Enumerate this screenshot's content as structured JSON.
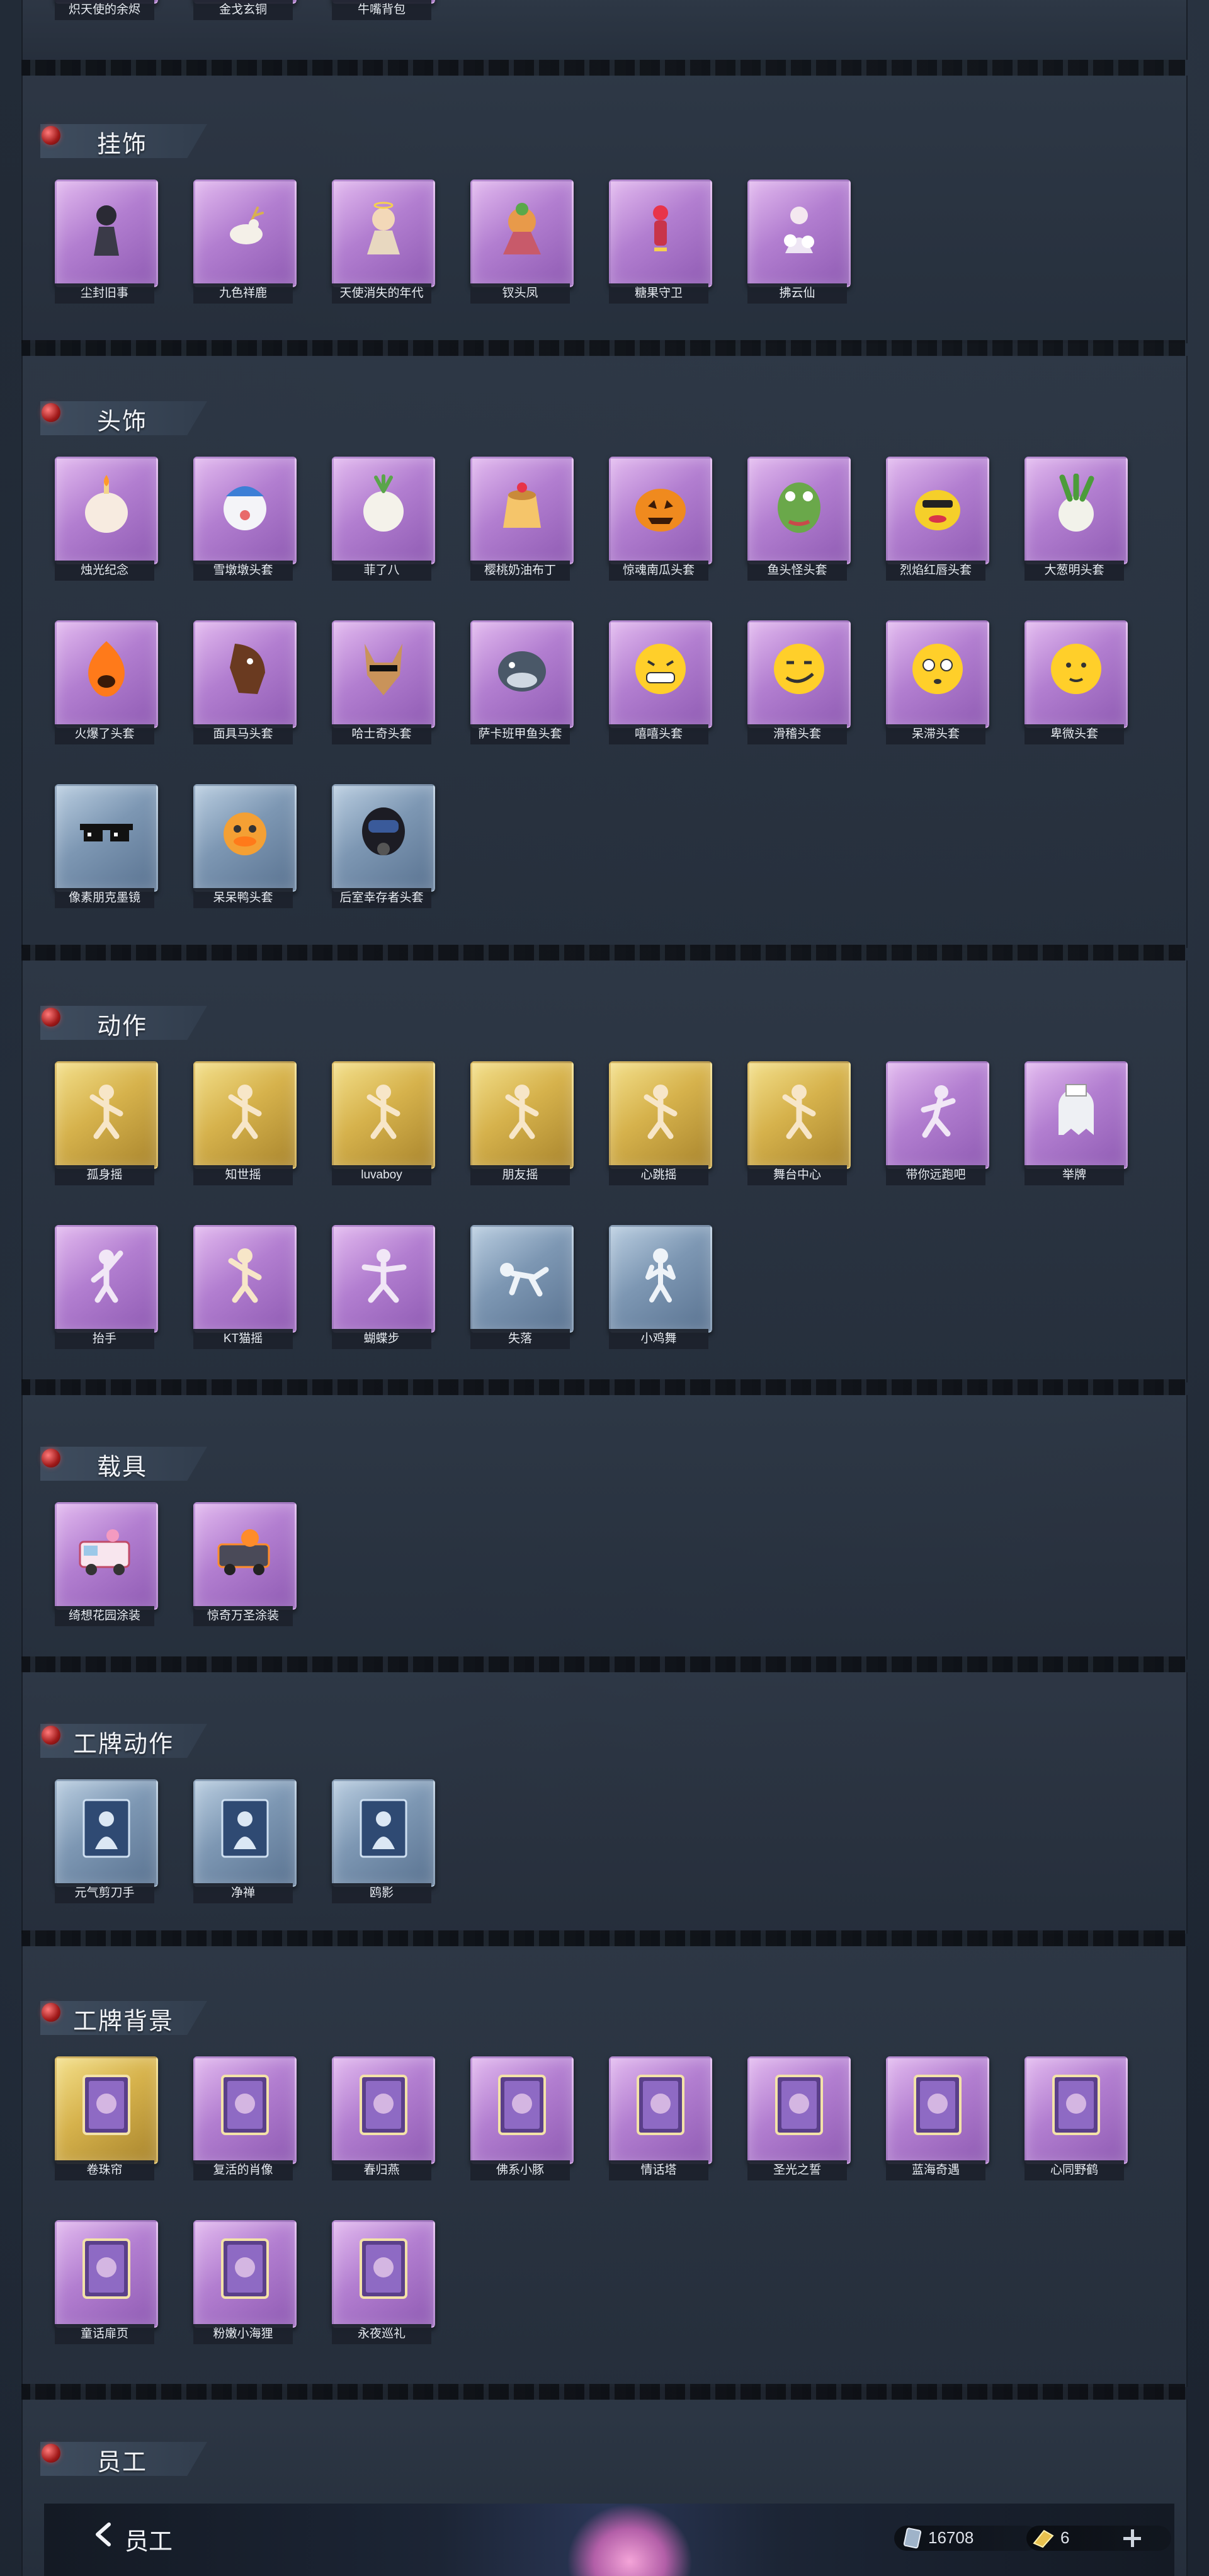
{
  "top_row": [
    {
      "label": "炽天使的余烬",
      "color": "purple"
    },
    {
      "label": "金戈玄铜",
      "color": "purple"
    },
    {
      "label": "牛嘴背包",
      "color": "purple"
    }
  ],
  "sections": {
    "pendant": {
      "title": "挂饰",
      "items": [
        {
          "label": "尘封旧事",
          "color": "purple",
          "icon": "figure-icon"
        },
        {
          "label": "九色祥鹿",
          "color": "purple",
          "icon": "deer-icon"
        },
        {
          "label": "天使消失的年代",
          "color": "purple",
          "icon": "angel-icon"
        },
        {
          "label": "钗头凤",
          "color": "purple",
          "icon": "phoenix-icon"
        },
        {
          "label": "糖果守卫",
          "color": "purple",
          "icon": "candy-guard-icon"
        },
        {
          "label": "拂云仙",
          "color": "purple",
          "icon": "cloud-fairy-icon"
        }
      ]
    },
    "headwear": {
      "title": "头饰",
      "items": [
        {
          "label": "烛光纪念",
          "color": "purple",
          "icon": "candle-head-icon"
        },
        {
          "label": "雪墩墩头套",
          "color": "purple",
          "icon": "snow-bear-icon"
        },
        {
          "label": "菲了八",
          "color": "purple",
          "icon": "radish-icon"
        },
        {
          "label": "樱桃奶油布丁",
          "color": "purple",
          "icon": "pudding-icon"
        },
        {
          "label": "惊魂南瓜头套",
          "color": "purple",
          "icon": "pumpkin-icon"
        },
        {
          "label": "鱼头怪头套",
          "color": "purple",
          "icon": "fish-head-icon"
        },
        {
          "label": "烈焰红唇头套",
          "color": "purple",
          "icon": "yellow-creature-icon"
        },
        {
          "label": "大葱明头套",
          "color": "purple",
          "icon": "scallion-icon"
        },
        {
          "label": "火爆了头套",
          "color": "purple",
          "icon": "fire-spirit-icon"
        },
        {
          "label": "面具马头套",
          "color": "purple",
          "icon": "horse-head-icon"
        },
        {
          "label": "哈士奇头套",
          "color": "purple",
          "icon": "husky-icon"
        },
        {
          "label": "萨卡班甲鱼头套",
          "color": "purple",
          "icon": "grey-fish-icon"
        },
        {
          "label": "嘻嘻头套",
          "color": "purple",
          "icon": "grin-emoji-icon"
        },
        {
          "label": "滑稽头套",
          "color": "purple",
          "icon": "smirk-emoji-icon"
        },
        {
          "label": "呆滞头套",
          "color": "purple",
          "icon": "dazed-emoji-icon"
        },
        {
          "label": "卑微头套",
          "color": "purple",
          "icon": "humble-emoji-icon"
        },
        {
          "label": "像素朋克墨镜",
          "color": "blue",
          "icon": "pixel-sunglasses-icon"
        },
        {
          "label": "呆呆鸭头套",
          "color": "blue",
          "icon": "duck-head-icon"
        },
        {
          "label": "后室幸存者头套",
          "color": "blue",
          "icon": "gas-mask-icon"
        }
      ]
    },
    "actions": {
      "title": "动作",
      "items": [
        {
          "label": "孤身摇",
          "color": "gold",
          "icon": "dance-pose-icon"
        },
        {
          "label": "知世摇",
          "color": "gold",
          "icon": "dance-pose-icon"
        },
        {
          "label": "luvaboy",
          "color": "gold",
          "icon": "dance-pose-icon"
        },
        {
          "label": "朋友摇",
          "color": "gold",
          "icon": "dance-pose-icon"
        },
        {
          "label": "心跳摇",
          "color": "gold",
          "icon": "dance-pose-icon"
        },
        {
          "label": "舞台中心",
          "color": "gold",
          "icon": "dance-pose-icon"
        },
        {
          "label": "带你远跑吧",
          "color": "purple",
          "icon": "run-pose-icon"
        },
        {
          "label": "举牌",
          "color": "purple",
          "icon": "ghost-sign-icon"
        },
        {
          "label": "抬手",
          "color": "purple",
          "icon": "raise-hand-icon"
        },
        {
          "label": "KT猫摇",
          "color": "purple",
          "icon": "dance-pose-icon"
        },
        {
          "label": "蝴蝶步",
          "color": "purple",
          "icon": "butterfly-step-icon"
        },
        {
          "label": "失落",
          "color": "blue",
          "icon": "crawl-pose-icon"
        },
        {
          "label": "小鸡舞",
          "color": "blue",
          "icon": "chicken-dance-icon"
        }
      ]
    },
    "vehicle": {
      "title": "载具",
      "items": [
        {
          "label": "绮想花园涂装",
          "color": "purple",
          "icon": "ice-cream-truck-icon"
        },
        {
          "label": "惊奇万圣涂装",
          "color": "purple",
          "icon": "halloween-truck-icon"
        }
      ]
    },
    "badge_action": {
      "title": "工牌动作",
      "items": [
        {
          "label": "元气剪刀手",
          "color": "blue",
          "icon": "silhouette-card-icon"
        },
        {
          "label": "净禅",
          "color": "blue",
          "icon": "silhouette-card-icon"
        },
        {
          "label": "鸥影",
          "color": "blue",
          "icon": "silhouette-card-icon"
        }
      ]
    },
    "badge_bg": {
      "title": "工牌背景",
      "items": [
        {
          "label": "卷珠帘",
          "color": "gold",
          "icon": "card-frame-icon"
        },
        {
          "label": "复活的肖像",
          "color": "purple",
          "icon": "card-frame-icon"
        },
        {
          "label": "春归燕",
          "color": "purple",
          "icon": "card-frame-icon"
        },
        {
          "label": "佛系小豚",
          "color": "purple",
          "icon": "card-frame-icon"
        },
        {
          "label": "情话塔",
          "color": "purple",
          "icon": "card-frame-icon"
        },
        {
          "label": "圣光之誓",
          "color": "purple",
          "icon": "card-frame-icon"
        },
        {
          "label": "蓝海奇遇",
          "color": "purple",
          "icon": "card-frame-icon"
        },
        {
          "label": "心同野鹤",
          "color": "purple",
          "icon": "card-frame-icon"
        },
        {
          "label": "童话扉页",
          "color": "purple",
          "icon": "card-frame-icon"
        },
        {
          "label": "粉嫩小海狸",
          "color": "purple",
          "icon": "card-frame-icon"
        },
        {
          "label": "永夜巡礼",
          "color": "purple",
          "icon": "card-frame-icon"
        }
      ]
    },
    "staff": {
      "title": "员工"
    }
  },
  "bottom_bar": {
    "title": "员工",
    "currency1": "16708",
    "currency2": "6"
  }
}
